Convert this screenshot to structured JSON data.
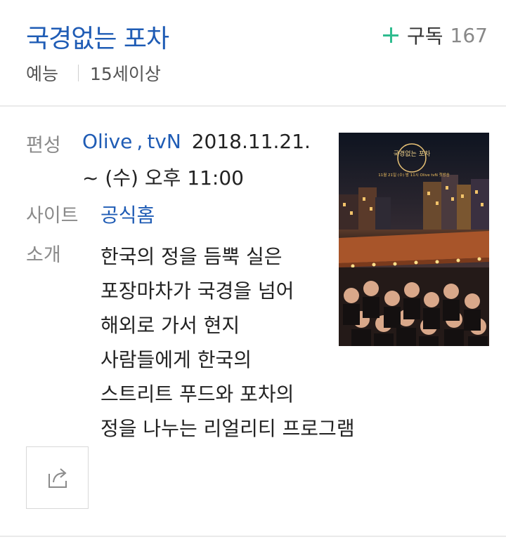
{
  "program": {
    "title": "국경없는 포차",
    "genre": "예능",
    "rating": "15세이상"
  },
  "subscribe": {
    "label": "구독",
    "count": "167",
    "accent_color": "#2fbc8f"
  },
  "info": {
    "broadcast_label": "편성",
    "channel_1": "Olive",
    "channel_sep": ",",
    "channel_2": "tvN",
    "date": "2018.11.21.",
    "time": "~ (수) 오후 11:00",
    "site_label": "사이트",
    "site_link": "공식홈",
    "intro_label": "소개",
    "description_lines": [
      "한국의 정을 듬뿍 실은",
      "포장마차가 국경을 넘어",
      "해외로 가서 현지",
      "사람들에게 한국의",
      "스트리트 푸드와 포차의",
      "정을 나누는 리얼리티 프로그램"
    ]
  },
  "poster": {
    "logo_text": "국경없는 포차",
    "caption": "11월 21일 (수) 밤 11시 Olive tvN 첫방송"
  },
  "actions": {
    "share_icon": "share-icon"
  },
  "colors": {
    "link": "#1f5cb5",
    "label": "#8a8a8a",
    "text": "#222222"
  }
}
